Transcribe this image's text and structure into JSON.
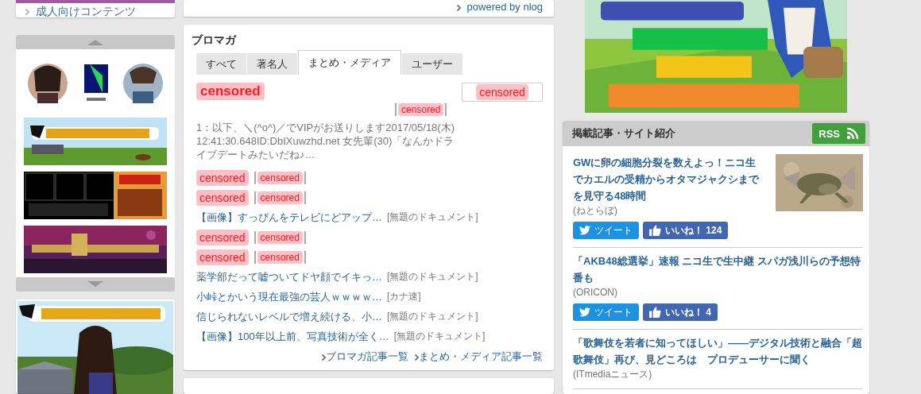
{
  "left": {
    "menu_item": "成人向けコンテンツ"
  },
  "powered_by": "powered by nlog",
  "blomaga": {
    "title": "ブロマガ",
    "tabs": [
      {
        "label": "すべて",
        "selected": false
      },
      {
        "label": "著名人",
        "selected": false
      },
      {
        "label": "まとめ・メディア",
        "selected": true
      },
      {
        "label": "ユーザー",
        "selected": false
      }
    ],
    "feature": {
      "title": "censored",
      "thumb": "censored",
      "source": "censored",
      "excerpt": "1：以下、＼(^o^)／でVIPがお送りします2017/05/18(木) 12:41:30.648ID:DbIXuwzhd.net 女先輩(30)「なんかドライブデートみたいだね♪…"
    },
    "entries": [
      {
        "kind": "censored",
        "title": "censored",
        "source": "censored"
      },
      {
        "kind": "censored",
        "title": "censored",
        "source": "censored"
      },
      {
        "kind": "link",
        "title": "【画像】すっぴんをテレビにどアップ…",
        "source": "[無題のドキュメント]"
      },
      {
        "kind": "censored",
        "title": "censored",
        "source": "censored"
      },
      {
        "kind": "censored",
        "title": "censored",
        "source": "censored"
      },
      {
        "kind": "link",
        "title": "薬学部だって嘘ついてドヤ顔でイキっ…",
        "source": "[無題のドキュメント]"
      },
      {
        "kind": "link",
        "title": "小峠とかいう現在最強の芸人ｗｗｗｗ…",
        "source": "[カナ速]"
      },
      {
        "kind": "link",
        "title": "信じられないレベルで増え続ける、小…",
        "source": "[無題のドキュメント]"
      },
      {
        "kind": "link",
        "title": "【画像】100年以上前、写真技術が全く…",
        "source": "[無題のドキュメント]"
      }
    ],
    "footer_links": [
      "ブロマガ記事一覧",
      "まとめ・メディア記事一覧"
    ]
  },
  "news": {
    "title": "掲載記事・サイト紹介",
    "rss": "RSS",
    "items": [
      {
        "title": "GWに卵の細胞分裂を数えよっ！ニコ生でカエルの受精からオタマジャクシまでを見守る48時間",
        "source": "(ねとらぼ)",
        "thumbnail": true,
        "tweet": "ツイート",
        "like": "いいね！",
        "count": "124"
      },
      {
        "title": "「AKB48総選挙」速報 ニコ生で生中継 スパガ浅川らの予想特番も",
        "source": "(ORICON)",
        "thumbnail": false,
        "tweet": "ツイート",
        "like": "いいね！",
        "count": "4"
      },
      {
        "title": "「歌舞伎を若者に知ってほしい」――デジタル技術と融合「超歌舞伎」再び、見どころは　プロデューサーに聞く",
        "source": "(ITmediaニュース)",
        "thumbnail": false
      }
    ]
  }
}
